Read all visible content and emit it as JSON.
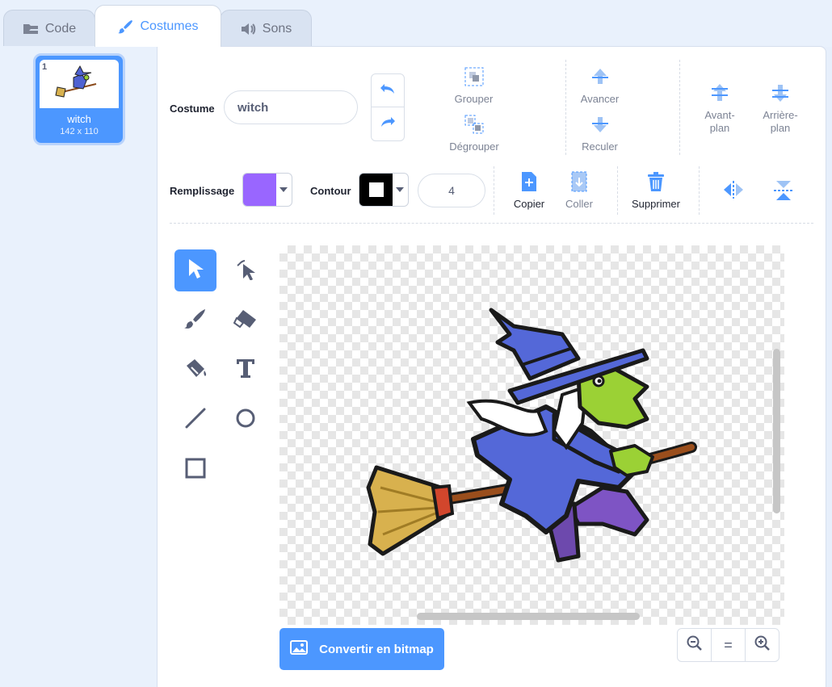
{
  "tabs": {
    "code": "Code",
    "costumes": "Costumes",
    "sounds": "Sons"
  },
  "costume_list": [
    {
      "number": "1",
      "name": "witch",
      "size": "142 x 110"
    }
  ],
  "costume": {
    "label": "Costume",
    "name_value": "witch"
  },
  "actions": {
    "group": "Grouper",
    "ungroup": "Dégrouper",
    "forward": "Avancer",
    "backward": "Reculer",
    "front": "Avant-\nplan",
    "back": "Arrière-\nplan",
    "copy": "Copier",
    "paste": "Coller",
    "delete": "Supprimer"
  },
  "fill": {
    "label": "Remplissage",
    "color": "#9966ff"
  },
  "outline": {
    "label": "Contour",
    "color": "#000000",
    "width": "4"
  },
  "tools": [
    "select",
    "reshape",
    "brush",
    "eraser",
    "fill",
    "text",
    "line",
    "circle",
    "rectangle"
  ],
  "convert_button": "Convertir en bitmap",
  "zoom": {
    "reset": "="
  },
  "colors": {
    "accent": "#4c97ff",
    "text": "#575e75"
  }
}
